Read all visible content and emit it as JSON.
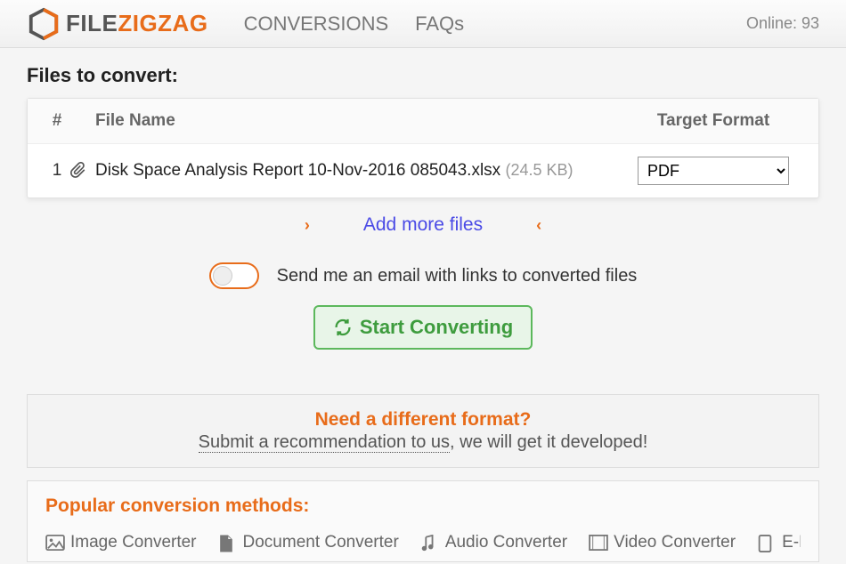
{
  "brand": {
    "part1": "FILE",
    "part2": "ZIGZAG"
  },
  "nav": {
    "conversions": "CONVERSIONS",
    "faqs": "FAQs"
  },
  "online": "Online: 93",
  "title": "Files to convert:",
  "headers": {
    "num": "#",
    "name": "File Name",
    "target": "Target Format"
  },
  "files": [
    {
      "num": "1",
      "name": "Disk Space Analysis Report 10-Nov-2016 085043.xlsx",
      "size": "(24.5 KB)",
      "target": "PDF"
    }
  ],
  "add_more": "Add more files",
  "email_label": "Send me an email with links to converted files",
  "start_label": "Start Converting",
  "need_title": "Need a different format?",
  "rec_link": "Submit a recommendation to us",
  "rec_rest": ", we will get it developed!",
  "popular_title": "Popular conversion methods:",
  "converters": {
    "image": "Image Converter",
    "document": "Document Converter",
    "audio": "Audio Converter",
    "video": "Video Converter",
    "ebook": "E-Boo"
  }
}
